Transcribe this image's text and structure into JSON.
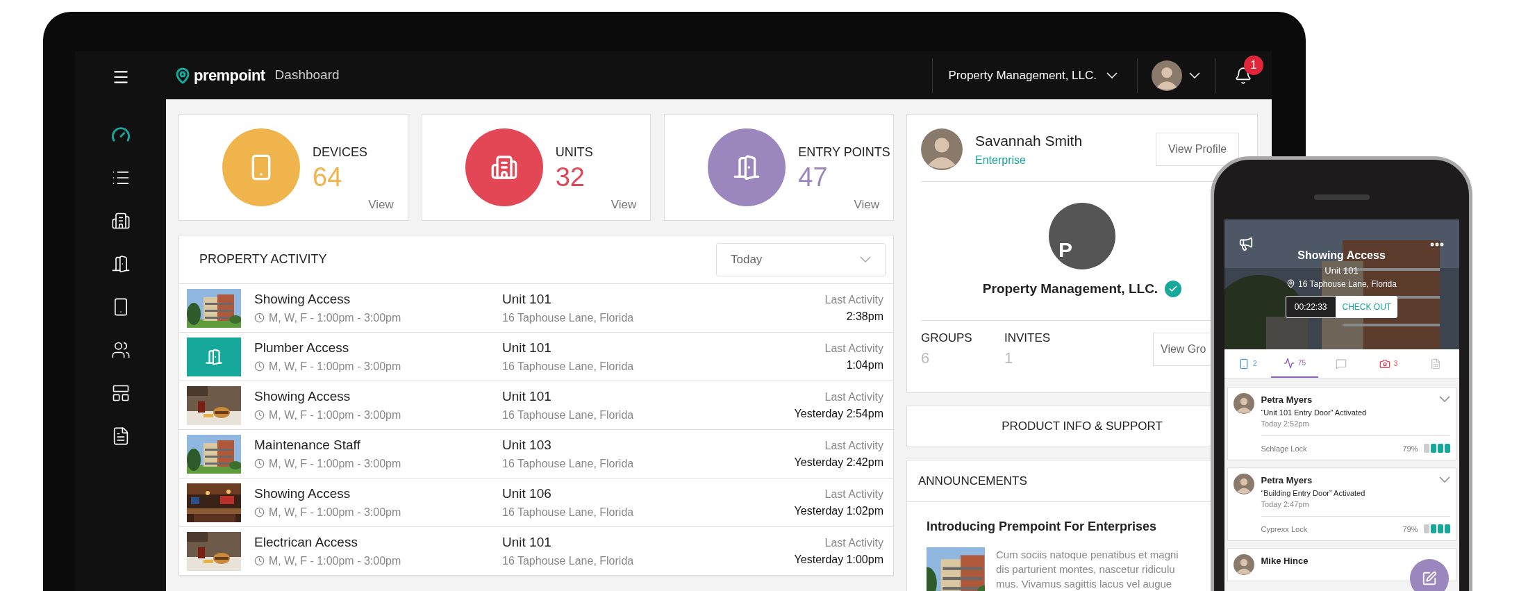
{
  "app": {
    "logo": "prempoint",
    "page_title": "Dashboard"
  },
  "top_bar": {
    "account": "Property Management, LLC.",
    "notification_count": "1"
  },
  "sidebar": {
    "items": [
      {
        "kind": "dashboard",
        "selected": true
      },
      {
        "kind": "list",
        "selected": false
      },
      {
        "kind": "buildings",
        "selected": false
      },
      {
        "kind": "door",
        "selected": false
      },
      {
        "kind": "device",
        "selected": false
      },
      {
        "kind": "users",
        "selected": false
      },
      {
        "kind": "layout",
        "selected": false
      },
      {
        "kind": "document",
        "selected": false
      }
    ]
  },
  "stats": [
    {
      "kind": "device",
      "label": "DEVICES",
      "value": "64",
      "link": "View",
      "color": "#f0b44c"
    },
    {
      "kind": "buildings",
      "label": "UNITS",
      "value": "32",
      "link": "View",
      "color": "#e34756"
    },
    {
      "kind": "door",
      "label": "ENTRY POINTS",
      "value": "47",
      "link": "View",
      "color": "#9b86bd"
    }
  ],
  "activity": {
    "title": "PROPERTY ACTIVITY",
    "filter": "Today",
    "rows": [
      {
        "kind": "picture",
        "title": "Showing Access",
        "schedule": "M, W, F - 1:00pm - 3:00pm",
        "unit": "Unit 101",
        "address": "16 Taphouse Lane, Florida",
        "last_label": "Last Activity",
        "last_time": "2:38pm"
      },
      {
        "kind": "door",
        "title": "Plumber Access",
        "schedule": "M, W, F - 1:00pm - 3:00pm",
        "unit": "Unit 101",
        "address": "16 Taphouse Lane, Florida",
        "last_label": "Last Activity",
        "last_time": "1:04pm"
      },
      {
        "kind": "picture",
        "title": "Showing Access",
        "schedule": "M, W, F - 1:00pm - 3:00pm",
        "unit": "Unit 101",
        "address": "16 Taphouse Lane, Florida",
        "last_label": "Last Activity",
        "last_time": "Yesterday 2:54pm"
      },
      {
        "kind": "picture",
        "title": "Maintenance Staff",
        "schedule": "M, W, F - 1:00pm - 3:00pm",
        "unit": "Unit 103",
        "address": "16 Taphouse Lane, Florida",
        "last_label": "Last Activity",
        "last_time": "Yesterday 2:42pm"
      },
      {
        "kind": "picture",
        "title": "Showing Access",
        "schedule": "M, W, F - 1:00pm - 3:00pm",
        "unit": "Unit 106",
        "address": "16 Taphouse Lane, Florida",
        "last_label": "Last Activity",
        "last_time": "Yesterday 1:02pm"
      },
      {
        "kind": "picture",
        "title": "Electrican Access",
        "schedule": "M, W, F - 1:00pm - 3:00pm",
        "unit": "Unit 101",
        "address": "16 Taphouse Lane, Florida",
        "last_label": "Last Activity",
        "last_time": "Yesterday 1:00pm"
      }
    ]
  },
  "profile": {
    "name": "Savannah Smith",
    "plan": "Enterprise",
    "button": "View Profile",
    "company_initial": "P",
    "company": "Property Management, LLC.",
    "verified": true,
    "counts": [
      {
        "label": "GROUPS",
        "value": "6"
      },
      {
        "label": "INVITES",
        "value": "1"
      }
    ],
    "groups_button": "View Gro"
  },
  "support": "PRODUCT INFO & SUPPORT",
  "announcements": {
    "title": "ANNOUNCEMENTS",
    "headline": "Introducing Prempoint For Enterprises",
    "lines": [
      "Cum sociis natoque penatibus et magni",
      "dis parturient montes, nascetur ridiculu",
      "mus. Vivamus sagittis lacus vel augue"
    ]
  },
  "phone": {
    "title": "Showing Access",
    "unit": "Unit 101",
    "address": "16 Taphouse Lane, Florida",
    "timer": "00:22:33",
    "action": "CHECK OUT",
    "tabs": [
      {
        "kind": "device",
        "count": "2",
        "color": "#4a9ad8",
        "selected": false
      },
      {
        "kind": "activity",
        "count": "75",
        "color": "#8a64b8",
        "selected": true
      },
      {
        "kind": "comment",
        "color": "#c4c4c4",
        "selected": false
      },
      {
        "kind": "camera",
        "count": "3",
        "color": "#e34756",
        "selected": false
      },
      {
        "kind": "document",
        "color": "#c4c4c4",
        "selected": false
      }
    ],
    "events": [
      {
        "name": "Petra Myers",
        "event": "“Unit 101 Entry Door” Activated",
        "time": "Today 2:52pm",
        "lock": "Schlage Lock",
        "battery": "79%",
        "level": 0.75
      },
      {
        "name": "Petra Myers",
        "event": "“Building Entry Door” Activated",
        "time": "Today 2:47pm",
        "lock": "Cyprexx Lock",
        "battery": "79%",
        "level": 0.75
      },
      {
        "name": "Mike Hince"
      }
    ]
  }
}
